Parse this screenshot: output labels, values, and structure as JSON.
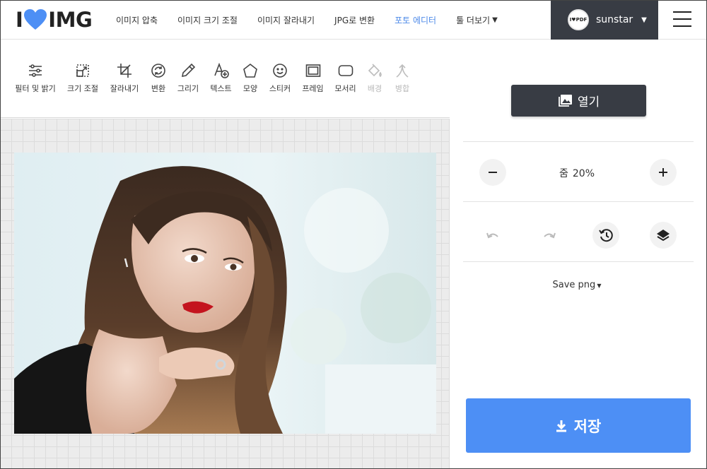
{
  "nav": {
    "logo_left": "I",
    "logo_right": "IMG",
    "links": [
      {
        "label": "이미지 압축"
      },
      {
        "label": "이미지 크기 조절"
      },
      {
        "label": "이미지 잘라내기"
      },
      {
        "label": "JPG로 변환"
      },
      {
        "label": "포토 에디터",
        "active": true
      },
      {
        "label": "툴 더보기"
      }
    ],
    "more_caret": "▼",
    "user": {
      "avatar_text": "I♥PDF",
      "name": "sunstar",
      "caret": "▼"
    }
  },
  "toolbar": {
    "tools": [
      {
        "label": "필터 및 밝기",
        "icon": "sliders-icon"
      },
      {
        "label": "크기 조절",
        "icon": "resize-icon"
      },
      {
        "label": "잘라내기",
        "icon": "crop-icon"
      },
      {
        "label": "변환",
        "icon": "rotate-icon"
      },
      {
        "label": "그리기",
        "icon": "pencil-icon"
      },
      {
        "label": "텍스트",
        "icon": "text-add-icon"
      },
      {
        "label": "모양",
        "icon": "pentagon-icon"
      },
      {
        "label": "스티커",
        "icon": "smiley-icon"
      },
      {
        "label": "프레임",
        "icon": "frame-icon"
      },
      {
        "label": "모서리",
        "icon": "rounded-corner-icon"
      },
      {
        "label": "배경",
        "icon": "paint-bucket-icon",
        "disabled": true
      },
      {
        "label": "병합",
        "icon": "merge-icon",
        "disabled": true
      }
    ]
  },
  "panel": {
    "open_label": "열기",
    "zoom_label": "줌",
    "zoom_value": "20%",
    "save_format": "Save png",
    "save_label": "저장"
  },
  "colors": {
    "accent": "#4d8ff5",
    "active_link": "#4d8ae8",
    "dark": "#383c44",
    "logo_heart": "#4d8ff5"
  }
}
